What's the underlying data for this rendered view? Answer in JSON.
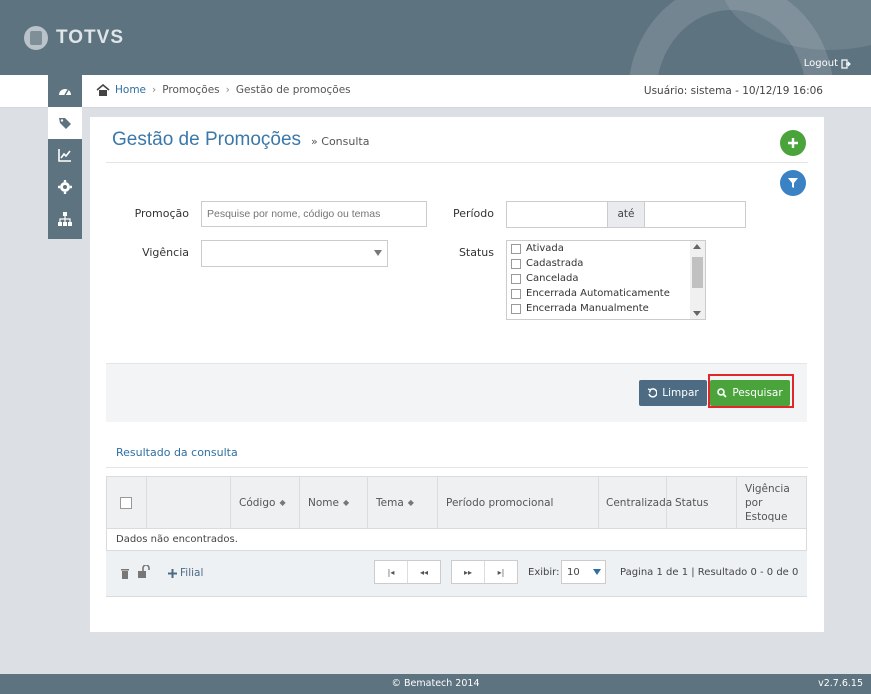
{
  "header": {
    "logo_text": "TOTVS",
    "logout_label": "Logout"
  },
  "breadcrumb": {
    "home": "Home",
    "items": [
      "Promoções",
      "Gestão de promoções"
    ],
    "user_info": "Usuário: sistema - 10/12/19 16:06"
  },
  "sidenav": {
    "items": [
      "dashboard-icon",
      "tags-icon",
      "chart-icon",
      "gear-icon",
      "sitemap-icon"
    ],
    "active_index": 1
  },
  "page": {
    "title": "Gestão de Promoções",
    "subtitle": "» Consulta"
  },
  "form": {
    "promocao_label": "Promoção",
    "promocao_placeholder": "Pesquise por nome, código ou temas",
    "promocao_value": "",
    "periodo_label": "Período",
    "periodo_start": "",
    "periodo_sep": "até",
    "periodo_end": "",
    "vigencia_label": "Vigência",
    "vigencia_value": "",
    "status_label": "Status",
    "status_options": [
      "Ativada",
      "Cadastrada",
      "Cancelada",
      "Encerrada Automaticamente",
      "Encerrada Manualmente"
    ]
  },
  "actions": {
    "limpar": "Limpar",
    "pesquisar": "Pesquisar"
  },
  "results": {
    "title": "Resultado da consulta",
    "columns": [
      "Código",
      "Nome",
      "Tema",
      "Período promocional",
      "Centralizada",
      "Status",
      "Vigência por Estoque"
    ],
    "empty_message": "Dados não encontrados.",
    "add_filial": "Filial",
    "exibir_label": "Exibir:",
    "page_size": "10",
    "page_info": "Pagina 1 de 1 | Resultado 0 - 0 de 0"
  },
  "footer": {
    "copyright": "© Bematech 2014",
    "version": "v2.7.6.15"
  },
  "colors": {
    "header": "#5d7380",
    "primary_blue": "#3b78aa",
    "success": "#4aa43b",
    "highlight": "#e0282c"
  }
}
